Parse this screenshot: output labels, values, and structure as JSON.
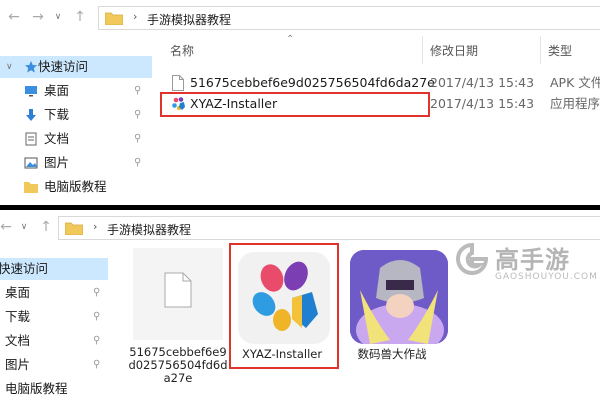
{
  "top": {
    "path": "手游模拟器教程",
    "columns": {
      "name": "名称",
      "date": "修改日期",
      "type": "类型"
    },
    "sidebar": [
      {
        "label": "快速访问",
        "icon": "star-icon",
        "selected": true
      },
      {
        "label": "桌面",
        "icon": "desktop-icon",
        "pinned": true
      },
      {
        "label": "下载",
        "icon": "download-icon",
        "pinned": true
      },
      {
        "label": "文档",
        "icon": "document-icon",
        "pinned": true
      },
      {
        "label": "图片",
        "icon": "pictures-icon",
        "pinned": true
      },
      {
        "label": "电脑版教程",
        "icon": "folder-icon"
      }
    ],
    "files": [
      {
        "name": "51675cebbef6e9d025756504fd6da27e",
        "date": "2017/4/13 15:43",
        "type": "APK 文件",
        "icon": "blank-file-icon"
      },
      {
        "name": "XYAZ-Installer",
        "date": "2017/4/13 15:43",
        "type": "应用程序",
        "icon": "xyaz-app-icon"
      }
    ]
  },
  "bottom": {
    "path": "手游模拟器教程",
    "sidebar": [
      {
        "label": "快速访问",
        "selected": true
      },
      {
        "label": "桌面",
        "pinned": true
      },
      {
        "label": "下载",
        "pinned": true
      },
      {
        "label": "文档",
        "pinned": true
      },
      {
        "label": "图片",
        "pinned": true
      },
      {
        "label": "电脑版教程"
      }
    ],
    "tiles": [
      {
        "label": "51675cebbef6e9d025756504fd6da27e",
        "icon": "blank-file-icon"
      },
      {
        "label": "XYAZ-Installer",
        "icon": "xyaz-app-icon"
      },
      {
        "label": "数码兽大作战",
        "icon": "game-app-icon"
      }
    ]
  },
  "watermark": {
    "brand": "高手游",
    "url": "GAOSHOUYOU.COM"
  },
  "colors": {
    "highlight": "#e0332c",
    "selected": "#cce8ff",
    "folder": "#f0c95a"
  }
}
